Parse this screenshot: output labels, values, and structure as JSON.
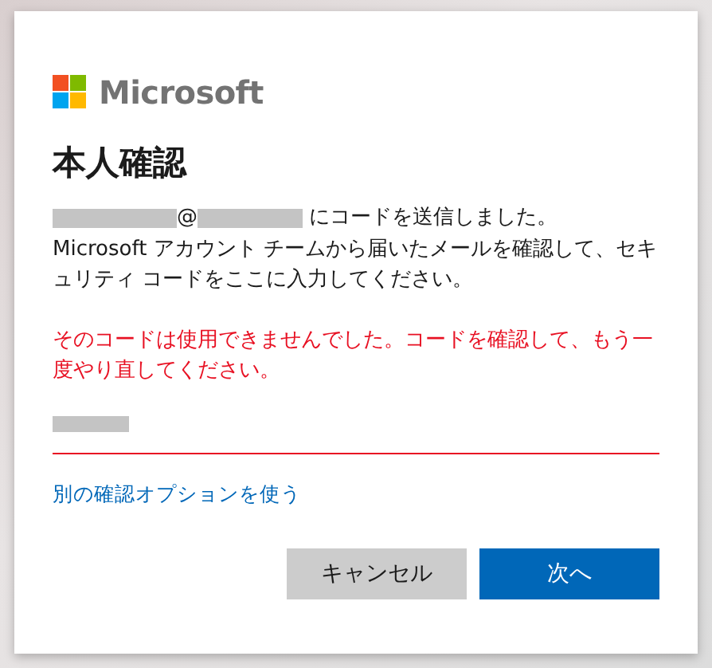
{
  "brand": {
    "name": "Microsoft"
  },
  "title": "本人確認",
  "sent_notice": {
    "at": "@",
    "text": "にコードを送信しました。"
  },
  "instructions": "Microsoft アカウント チームから届いたメールを確認して、セキュリティ コードをここに入力してください。",
  "error": "そのコードは使用できませんでした。コードを確認して、もう一度やり直してください。",
  "code_field": {
    "invalid": true
  },
  "other_option_link": "別の確認オプションを使う",
  "buttons": [
    {
      "label": "キャンセル",
      "kind": "secondary"
    },
    {
      "label": "次へ",
      "kind": "primary"
    }
  ]
}
